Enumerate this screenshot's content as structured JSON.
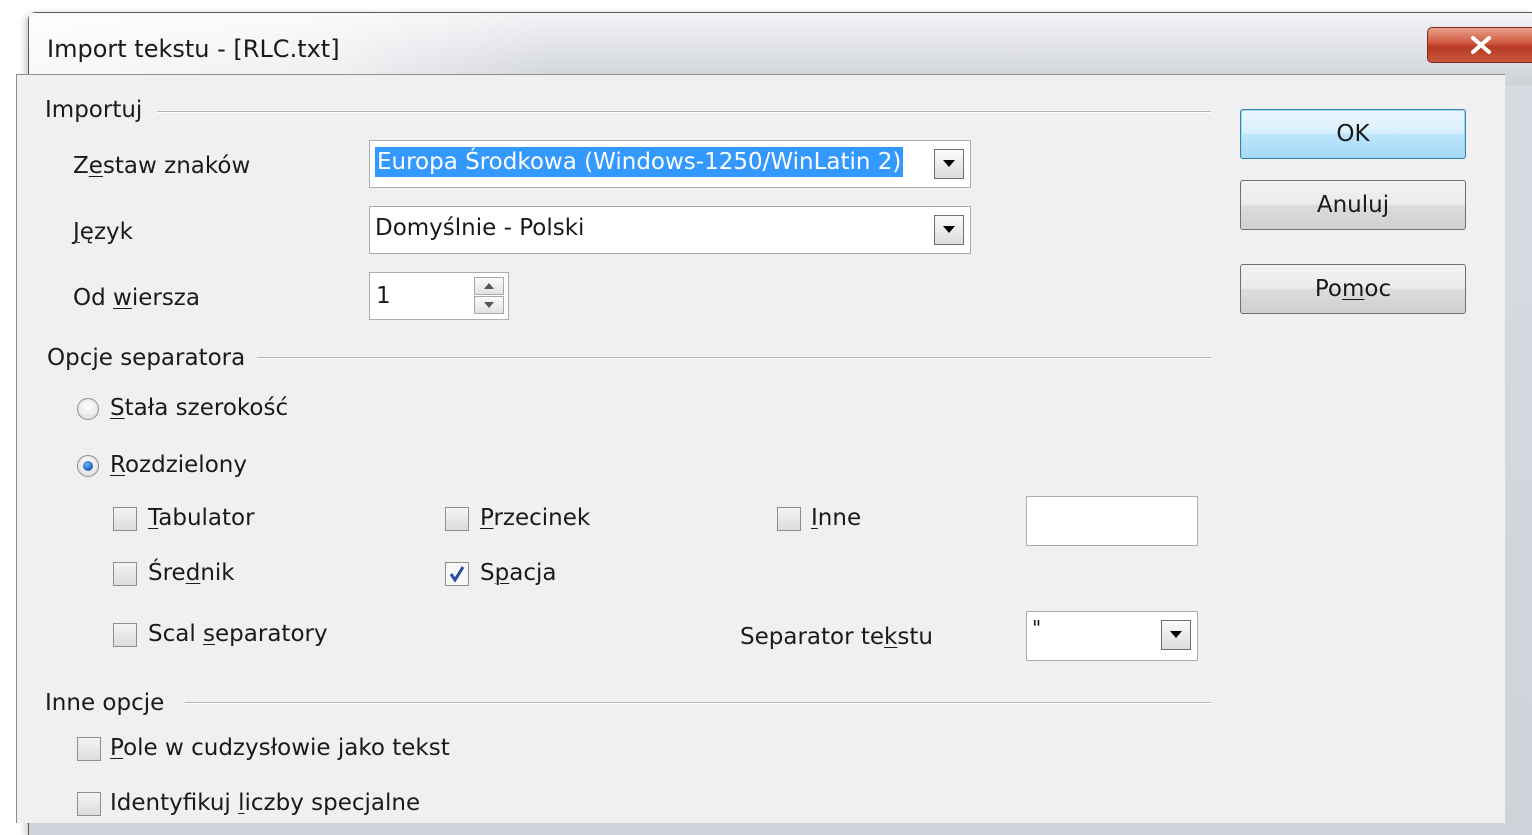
{
  "window": {
    "title": "Import tekstu - [RLC.txt]",
    "close_label": "x"
  },
  "import_group": {
    "label": "Importuj",
    "charset": {
      "label": "Zestaw znaków",
      "value": "Europa Środkowa (Windows-1250/WinLatin 2)"
    },
    "language": {
      "label": "Język",
      "value": "Domyślnie - Polski"
    },
    "from_row": {
      "label": "Od wiersza",
      "value": "1"
    }
  },
  "separator_group": {
    "label": "Opcje separatora",
    "fixed_width": {
      "label": "Stała szerokość",
      "selected": false
    },
    "separated": {
      "label": "Rozdzielony",
      "selected": true
    },
    "tab": {
      "label": "Tabulator",
      "checked": false
    },
    "comma": {
      "label": "Przecinek",
      "checked": false
    },
    "other": {
      "label": "Inne",
      "checked": false,
      "value": ""
    },
    "semicolon": {
      "label": "Średnik",
      "checked": false
    },
    "space": {
      "label": "Spacja",
      "checked": true
    },
    "merge": {
      "label": "Scal separatory",
      "checked": false
    },
    "text_separator": {
      "label": "Separator tekstu",
      "value": "\""
    }
  },
  "other_group": {
    "label": "Inne opcje",
    "quoted_as_text": {
      "label": "Pole w cudzysłowie jako tekst",
      "checked": false
    },
    "detect_special": {
      "label": "Identyfikuj liczby specjalne",
      "checked": false
    }
  },
  "buttons": {
    "ok": "OK",
    "cancel": "Anuluj",
    "help": "Pomoc"
  },
  "colors": {
    "selection": "#3399ff",
    "close_button": "#c7583f",
    "default_button": "#3c7fb1"
  }
}
